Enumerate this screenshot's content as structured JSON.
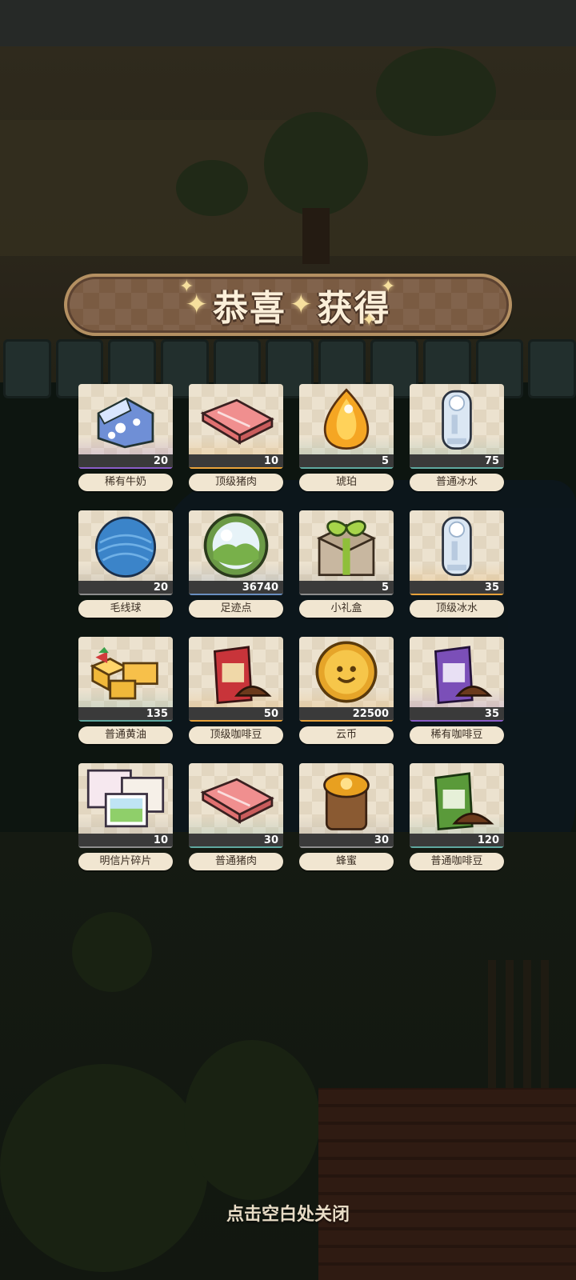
{
  "banner": {
    "title_part1": "恭喜",
    "title_part2": "获得"
  },
  "rarity_colors": {
    "purple": "#8a5cc8",
    "blue": "#6a8fc0",
    "orange": "#e8a23a",
    "teal": "#5fa8a0",
    "gray": "#8d8d8d"
  },
  "rewards": [
    {
      "name": "稀有牛奶",
      "qty": "20",
      "icon": "milk-carton-icon",
      "rarity": "purple"
    },
    {
      "name": "顶级猪肉",
      "qty": "10",
      "icon": "pork-slab-icon",
      "rarity": "orange"
    },
    {
      "name": "琥珀",
      "qty": "5",
      "icon": "amber-gem-icon",
      "rarity": "teal"
    },
    {
      "name": "普通冰水",
      "qty": "75",
      "icon": "ice-water-bottle-icon",
      "rarity": "teal"
    },
    {
      "name": "毛线球",
      "qty": "20",
      "icon": "yarn-ball-icon",
      "rarity": "gray"
    },
    {
      "name": "足迹点",
      "qty": "36740",
      "icon": "footprint-orb-icon",
      "rarity": "blue"
    },
    {
      "name": "小礼盒",
      "qty": "5",
      "icon": "gift-box-icon",
      "rarity": "gray"
    },
    {
      "name": "顶级冰水",
      "qty": "35",
      "icon": "ice-water-bottle-icon",
      "rarity": "orange"
    },
    {
      "name": "普通黄油",
      "qty": "135",
      "icon": "butter-blocks-icon",
      "rarity": "teal"
    },
    {
      "name": "顶级咖啡豆",
      "qty": "50",
      "icon": "coffee-bag-red-icon",
      "rarity": "orange"
    },
    {
      "name": "云币",
      "qty": "22500",
      "icon": "cloud-coin-icon",
      "rarity": "orange"
    },
    {
      "name": "稀有咖啡豆",
      "qty": "35",
      "icon": "coffee-bag-purple-icon",
      "rarity": "purple"
    },
    {
      "name": "明信片碎片",
      "qty": "10",
      "icon": "postcard-icon",
      "rarity": "gray"
    },
    {
      "name": "普通猪肉",
      "qty": "30",
      "icon": "pork-slab-icon",
      "rarity": "teal"
    },
    {
      "name": "蜂蜜",
      "qty": "30",
      "icon": "honey-jar-icon",
      "rarity": "gray"
    },
    {
      "name": "普通咖啡豆",
      "qty": "120",
      "icon": "coffee-bag-green-icon",
      "rarity": "teal"
    }
  ],
  "close_hint": "点击空白处关闭"
}
